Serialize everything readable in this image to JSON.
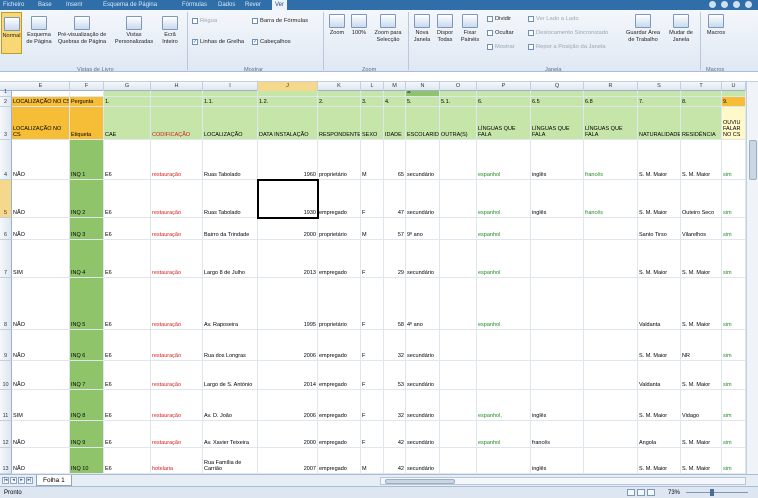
{
  "ribbon": {
    "tabs": [
      "Ficheiro",
      "Base",
      "Inserir",
      "Esquema de Página",
      "Fórmulas",
      "Dados",
      "Rever",
      "Ver"
    ],
    "active_tab": "Ver",
    "buttons": {
      "normal": "Normal",
      "page_layout": "Esquema\nde Página",
      "page_break": "Pré-visualização de\nQuebras de Página",
      "custom_views": "Vistas\nPersonalizadas",
      "full_screen": "Ecrã\nInteiro",
      "zoom": "Zoom",
      "zoom_100": "100%",
      "zoom_selection": "Zoom para\nSelecção",
      "new_window": "Nova\nJanela",
      "arrange_all": "Dispor\nTodas",
      "freeze_panes": "Fixar\nPainéis",
      "split": "Dividir",
      "hide": "Ocultar",
      "unhide": "Mostrar",
      "side_by_side": "Ver Lado a Lado",
      "sync_scroll": "Deslocamento Sincronizado",
      "reset_pos": "Repor a Posição da Janela",
      "save_workspace": "Guardar Área\nde Trabalho",
      "switch_windows": "Mudar de\nJanela",
      "macros": "Macros"
    },
    "checkboxes": {
      "ruler": "Régua",
      "formula_bar": "Barra de Fórmulas",
      "gridlines": "Linhas de Grelha",
      "headings": "Cabeçalhos"
    },
    "groups": [
      "Vistas de Livro",
      "Mostrar",
      "Zoom",
      "Janela",
      "Macros"
    ]
  },
  "grid": {
    "columns": [
      "E",
      "F",
      "G",
      "H",
      "I",
      "J",
      "K",
      "L",
      "M",
      "N",
      "O",
      "P",
      "Q",
      "R",
      "S",
      "T",
      "U"
    ],
    "selected_column": "J",
    "row_numbers": [
      "1",
      "2",
      "3",
      "4",
      "5",
      "6",
      "7",
      "8",
      "9",
      "10",
      "11",
      "12",
      "13"
    ],
    "selected_row": "5",
    "row1": {
      "n": "9."
    },
    "row2": [
      "LOCALIZAÇÃO NO CS",
      "Pergunta",
      "1.",
      "",
      "1.1.",
      "1.2.",
      "2.",
      "3.",
      "4.",
      "5.",
      "5.1.",
      "6.",
      "6.5",
      "6.8",
      "7.",
      "8.",
      "9."
    ],
    "row3": [
      "LOCALIZAÇÃO NO CS",
      "Etiqueta",
      "CAE",
      "CODIFICAÇÃO",
      "LOCALIZAÇÃO",
      "DATA INSTALAÇÃO",
      "RESPONDENTE",
      "SEXO",
      "IDADE",
      "ESCOLARIDADE",
      "OUTRA(S)",
      "LÍNGUAS QUE FALA",
      "LÍNGUAS QUE FALA",
      "LÍNGUAS QUE FALA",
      "NATURALIDADE",
      "RESIDÊNCIA",
      "OUVIU FALAR NO CS"
    ],
    "data_rows": [
      [
        "NÃO",
        "INQ 1",
        "E6",
        "restauração",
        "Ruas Tabolado",
        "1960",
        "proprietário",
        "M",
        "65",
        "secundário",
        "",
        "espanhol",
        "inglês",
        "francês",
        "S. M. Maior",
        "S. M. Maior",
        "sim"
      ],
      [
        "NÃO",
        "INQ 2",
        "E6",
        "restauração",
        "Ruas Tabolado",
        "1930",
        "empregado",
        "F",
        "47",
        "secundário",
        "",
        "espanhol",
        "inglês",
        "francês",
        "S. M. Maior",
        "Outeiro Seco",
        "sim"
      ],
      [
        "NÃO",
        "INQ 3",
        "E6",
        "restauração",
        "Bairro da Trindade",
        "2000",
        "proprietário",
        "M",
        "57",
        "9º ano",
        "",
        "espanhol",
        "",
        "",
        "Santo Tirso",
        "Vilarelhos",
        "sim"
      ],
      [
        "SIM",
        "INQ 4",
        "E6",
        "restauração",
        "Largo 8 de Julho",
        "2013",
        "empregado",
        "F",
        "29",
        "secundário",
        "",
        "espanhol",
        "",
        "",
        "S. M. Maior",
        "S. M. Maior",
        "sim"
      ],
      [
        "NÃO",
        "INQ 5",
        "E6",
        "restauração",
        "Av. Raposeira",
        "1995",
        "proprietário",
        "F",
        "58",
        "4º ano",
        "",
        "espanhol",
        "",
        "",
        "Valdanta",
        "S. M. Maior",
        "sim"
      ],
      [
        "NÃO",
        "INQ 6",
        "E6",
        "restauração",
        "Rua dos Longras",
        "2006",
        "empregado",
        "F",
        "32",
        "secundário",
        "",
        "",
        "",
        "",
        "S. M. Maior",
        "NR",
        "sim"
      ],
      [
        "NÃO",
        "INQ 7",
        "E6",
        "restauração",
        "Largo de S. António",
        "2014",
        "empregado",
        "F",
        "53",
        "secundário",
        "",
        "",
        "",
        "",
        "Valdanta",
        "S. M. Maior",
        "sim"
      ],
      [
        "SIM",
        "INQ 8",
        "E6",
        "restauração",
        "Av. D. João",
        "2006",
        "empregado",
        "F",
        "32",
        "secundário",
        "",
        "espanhol,",
        "inglês",
        "",
        "S. M. Maior",
        "Vidago",
        "sim"
      ],
      [
        "NÃO",
        "INQ 9",
        "E6",
        "restauração",
        "Av. Xavier Teixeira",
        "2000",
        "empregado",
        "F",
        "42",
        "secundário",
        "",
        "espanhol",
        "francês",
        "",
        "Angola",
        "S. M. Maior",
        "sim"
      ],
      [
        "NÃO",
        "INQ 10",
        "E6",
        "hotelaria",
        "Rua Família de Carrião",
        "2007",
        "empregado",
        "M",
        "42",
        "secundário",
        "",
        "",
        "inglês",
        "",
        "S. M. Maior",
        "S. M. Maior",
        "sim"
      ]
    ]
  },
  "sheet": {
    "name": "Folha 1"
  },
  "status": {
    "ready": "Pronto",
    "zoom": "73%"
  }
}
